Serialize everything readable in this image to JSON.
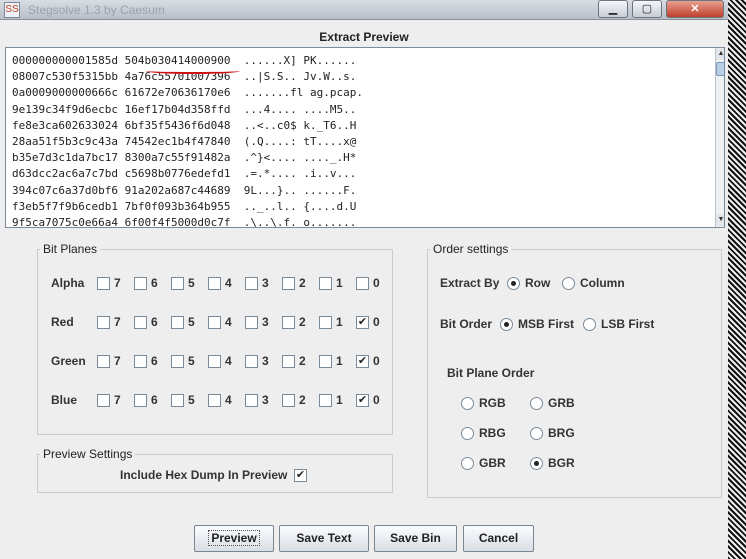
{
  "window": {
    "title": "Stegsolve 1.3 by Caesum",
    "app_icon": "SS",
    "min_icon": "minimize-icon",
    "max_icon": "maximize-icon",
    "close_icon": "close-icon",
    "min_glyph": "▁",
    "max_glyph": "▢",
    "close_glyph": "✕"
  },
  "preview": {
    "heading": "Extract Preview",
    "lines": [
      "000000000001585d 504b030414000900  ......X] PK......",
      "08007c530f5315bb 4a76c55701007396  ..|S.S.. Jv.W..s.",
      "0a0009000000666c 61672e70636170e6  .......fl ag.pcap.",
      "9e139c34f9d6ecbc 16ef17b04d358ffd  ...4.... ....M5..",
      "fe8e3ca602633024 6bf35f5436f6d048  ..<..c0$ k._T6..H",
      "28aa51f5b3c9c43a 74542ec1b4f47840  (.Q....: tT....x@",
      "b35e7d3c1da7bc17 8300a7c55f91482a  .^}<.... ...._.H*",
      "d63dcc2ac6a7c7bd c5698b0776edefd1  .=.*.... .i..v...",
      "394c07c6a37d0bf6 91a202a687c44689  9L...}.. ......F.",
      "f3eb5f7f9b6cedb1 7bf0f093b364b955  .._..l.. {....d.U",
      "9f5ca7075c0e66a4 6f00f4f5000d0c7f  .\\..\\.f. o......."
    ],
    "scroll_up_glyph": "▲",
    "scroll_down_glyph": "▼"
  },
  "bit_planes": {
    "title": "Bit Planes",
    "bits": [
      "7",
      "6",
      "5",
      "4",
      "3",
      "2",
      "1",
      "0"
    ],
    "rows": [
      {
        "label": "Alpha",
        "checked": [
          false,
          false,
          false,
          false,
          false,
          false,
          false,
          false
        ]
      },
      {
        "label": "Red",
        "checked": [
          false,
          false,
          false,
          false,
          false,
          false,
          false,
          true
        ]
      },
      {
        "label": "Green",
        "checked": [
          false,
          false,
          false,
          false,
          false,
          false,
          false,
          true
        ]
      },
      {
        "label": "Blue",
        "checked": [
          false,
          false,
          false,
          false,
          false,
          false,
          false,
          true
        ]
      }
    ],
    "check_glyph": "✔"
  },
  "preview_settings": {
    "title": "Preview Settings",
    "hex_dump_label": "Include Hex Dump In Preview",
    "hex_dump_checked": true
  },
  "order_settings": {
    "title": "Order settings",
    "extract_by_label": "Extract By",
    "extract_by_options": [
      "Row",
      "Column"
    ],
    "extract_by_selected": "Row",
    "bit_order_label": "Bit Order",
    "bit_order_options": [
      "MSB First",
      "LSB First"
    ],
    "bit_order_selected": "MSB First",
    "plane_order_label": "Bit Plane Order",
    "plane_order_options": [
      "RGB",
      "GRB",
      "RBG",
      "BRG",
      "GBR",
      "BGR"
    ],
    "plane_order_selected": "BGR"
  },
  "buttons": {
    "preview": "Preview",
    "save_text": "Save Text",
    "save_bin": "Save Bin",
    "cancel": "Cancel"
  },
  "colors": {
    "annotation": "#d01010",
    "window_bg": "#eeeeee"
  }
}
